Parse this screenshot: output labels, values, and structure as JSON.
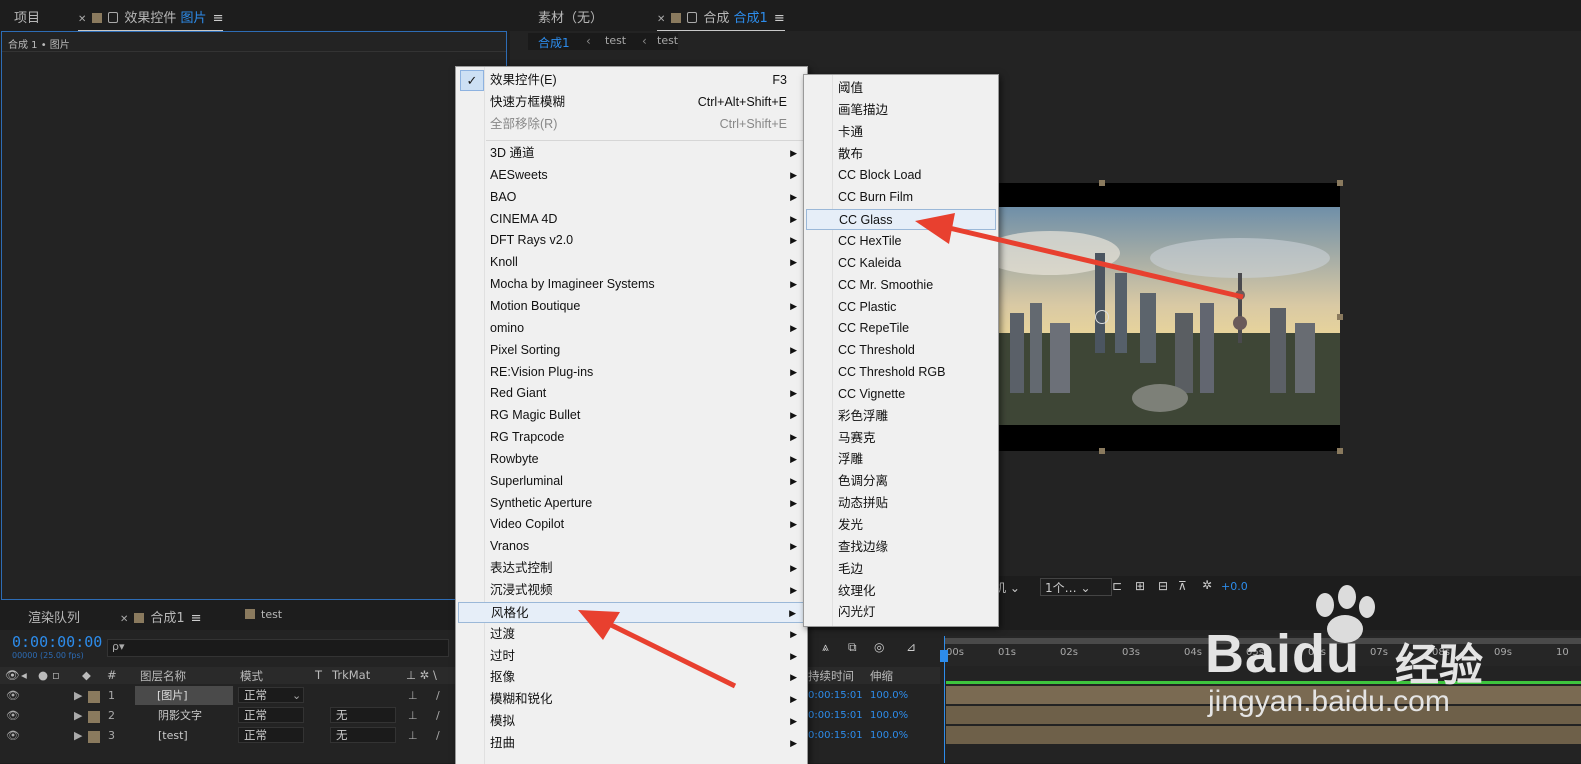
{
  "project_panel": {
    "tab_project": "项目",
    "tab_effect_prefix": "效果控件",
    "tab_effect_target": "图片",
    "breadcrumb": "合成 1 • 图片"
  },
  "comp_panel": {
    "tab_footage": "素材（无）",
    "tab_comp_prefix": "合成",
    "tab_comp_name": "合成1",
    "nav_items": [
      "合成1",
      "test",
      "test"
    ],
    "viewer_controls": {
      "view_label": "机",
      "count_label": "1个…",
      "exposure": "+0.0"
    }
  },
  "timeline": {
    "tab_render": "渲染队列",
    "tab_comp": "合成1",
    "tab_test": "test",
    "timecode": "0:00:00:00",
    "timecode_sub": "00000 (25.00 fps)",
    "search_placeholder": "ρ▾",
    "col_hash": "#",
    "col_name": "图层名称",
    "col_mode": "模式",
    "col_t": "T",
    "col_trkmat": "TrkMat",
    "col_duration": "持续时间",
    "col_stretch": "伸缩",
    "layers": [
      {
        "num": "1",
        "name": "[图片]",
        "mode": "正常",
        "trkmat": "",
        "duration": "0:00:15:01",
        "stretch": "100.0%"
      },
      {
        "num": "2",
        "name": "阴影文字",
        "mode": "正常",
        "trkmat": "无",
        "duration": "0:00:15:01",
        "stretch": "100.0%"
      },
      {
        "num": "3",
        "name": "[test]",
        "mode": "正常",
        "trkmat": "无",
        "duration": "0:00:15:01",
        "stretch": "100.0%"
      }
    ],
    "ruler": [
      "00s",
      "01s",
      "02s",
      "03s",
      "04s",
      "05s",
      "06s",
      "07s",
      "08s",
      "09s",
      "10"
    ]
  },
  "main_menu": {
    "top_items": [
      {
        "label": "效果控件(E)",
        "shortcut": "F3",
        "checked": true
      },
      {
        "label": "快速方框模糊",
        "shortcut": "Ctrl+Alt+Shift+E"
      },
      {
        "label": "全部移除(R)",
        "shortcut": "Ctrl+Shift+E",
        "disabled": true
      }
    ],
    "categories": [
      "3D 通道",
      "AESweets",
      "BAO",
      "CINEMA 4D",
      "DFT Rays v2.0",
      "Knoll",
      "Mocha by Imagineer Systems",
      "Motion Boutique",
      "omino",
      "Pixel Sorting",
      "RE:Vision Plug-ins",
      "Red Giant",
      "RG Magic Bullet",
      "RG Trapcode",
      "Rowbyte",
      "Superluminal",
      "Synthetic Aperture",
      "Video Copilot",
      "Vranos",
      "表达式控制",
      "沉浸式视频",
      "风格化",
      "过渡",
      "过时",
      "抠像",
      "模糊和锐化",
      "模拟",
      "扭曲"
    ],
    "highlighted": "风格化"
  },
  "submenu": {
    "items": [
      "阈值",
      "画笔描边",
      "卡通",
      "散布",
      "CC Block Load",
      "CC Burn Film",
      "CC Glass",
      "CC HexTile",
      "CC Kaleida",
      "CC Mr. Smoothie",
      "CC Plastic",
      "CC RepeTile",
      "CC Threshold",
      "CC Threshold RGB",
      "CC Vignette",
      "彩色浮雕",
      "马赛克",
      "浮雕",
      "色调分离",
      "动态拼贴",
      "发光",
      "查找边缘",
      "毛边",
      "纹理化",
      "闪光灯"
    ],
    "highlighted": "CC Glass"
  },
  "watermark": {
    "brand": "Baidu",
    "cn": "经验",
    "url": "jingyan.baidu.com"
  },
  "colors": {
    "accent_blue": "#2d8ceb",
    "arrow_red": "#e8402f",
    "menu_bg": "#f0f0f0",
    "panel_bg": "#232323"
  }
}
